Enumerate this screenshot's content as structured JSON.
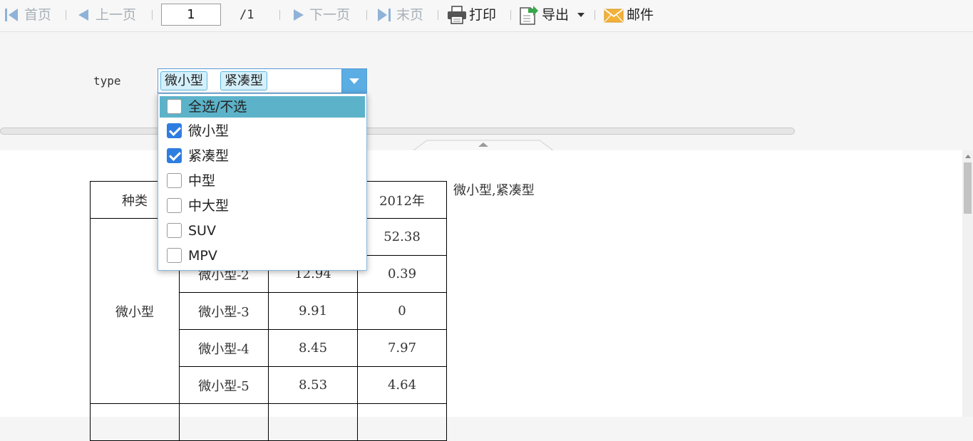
{
  "toolbar": {
    "first_label": "首页",
    "prev_label": "上一页",
    "page_value": "1",
    "total_pages": "/1",
    "next_label": "下一页",
    "last_label": "末页",
    "print_label": "打印",
    "export_label": "导出",
    "mail_label": "邮件"
  },
  "param": {
    "label": "type",
    "selected_tags": [
      "微小型",
      "紧凑型"
    ]
  },
  "dropdown": {
    "options": [
      {
        "label": "全选/不选",
        "checked": false,
        "highlighted": true
      },
      {
        "label": "微小型",
        "checked": true,
        "highlighted": false
      },
      {
        "label": "紧凑型",
        "checked": true,
        "highlighted": false
      },
      {
        "label": "中型",
        "checked": false,
        "highlighted": false
      },
      {
        "label": "中大型",
        "checked": false,
        "highlighted": false
      },
      {
        "label": "SUV",
        "checked": false,
        "highlighted": false
      },
      {
        "label": "MPV",
        "checked": false,
        "highlighted": false
      }
    ]
  },
  "report": {
    "header_col1": "种类",
    "header_col4": "2012年",
    "group_label": "微小型",
    "rows": [
      {
        "sub": "",
        "v2011": "",
        "v2012": "52.38"
      },
      {
        "sub": "微小型-2",
        "v2011": "12.94",
        "v2012": "0.39"
      },
      {
        "sub": "微小型-3",
        "v2011": "9.91",
        "v2012": "0"
      },
      {
        "sub": "微小型-4",
        "v2011": "8.45",
        "v2012": "7.97"
      },
      {
        "sub": "微小型-5",
        "v2011": "8.53",
        "v2012": "4.64"
      }
    ],
    "selection_text": "微小型,紧凑型"
  },
  "colors": {
    "accent": "#5aaee3",
    "checkbox_checked": "#2e7de0",
    "highlight_row": "#5cb3c9",
    "tag_bg": "#d4f0fb",
    "disabled_text": "#a8b0b8"
  }
}
